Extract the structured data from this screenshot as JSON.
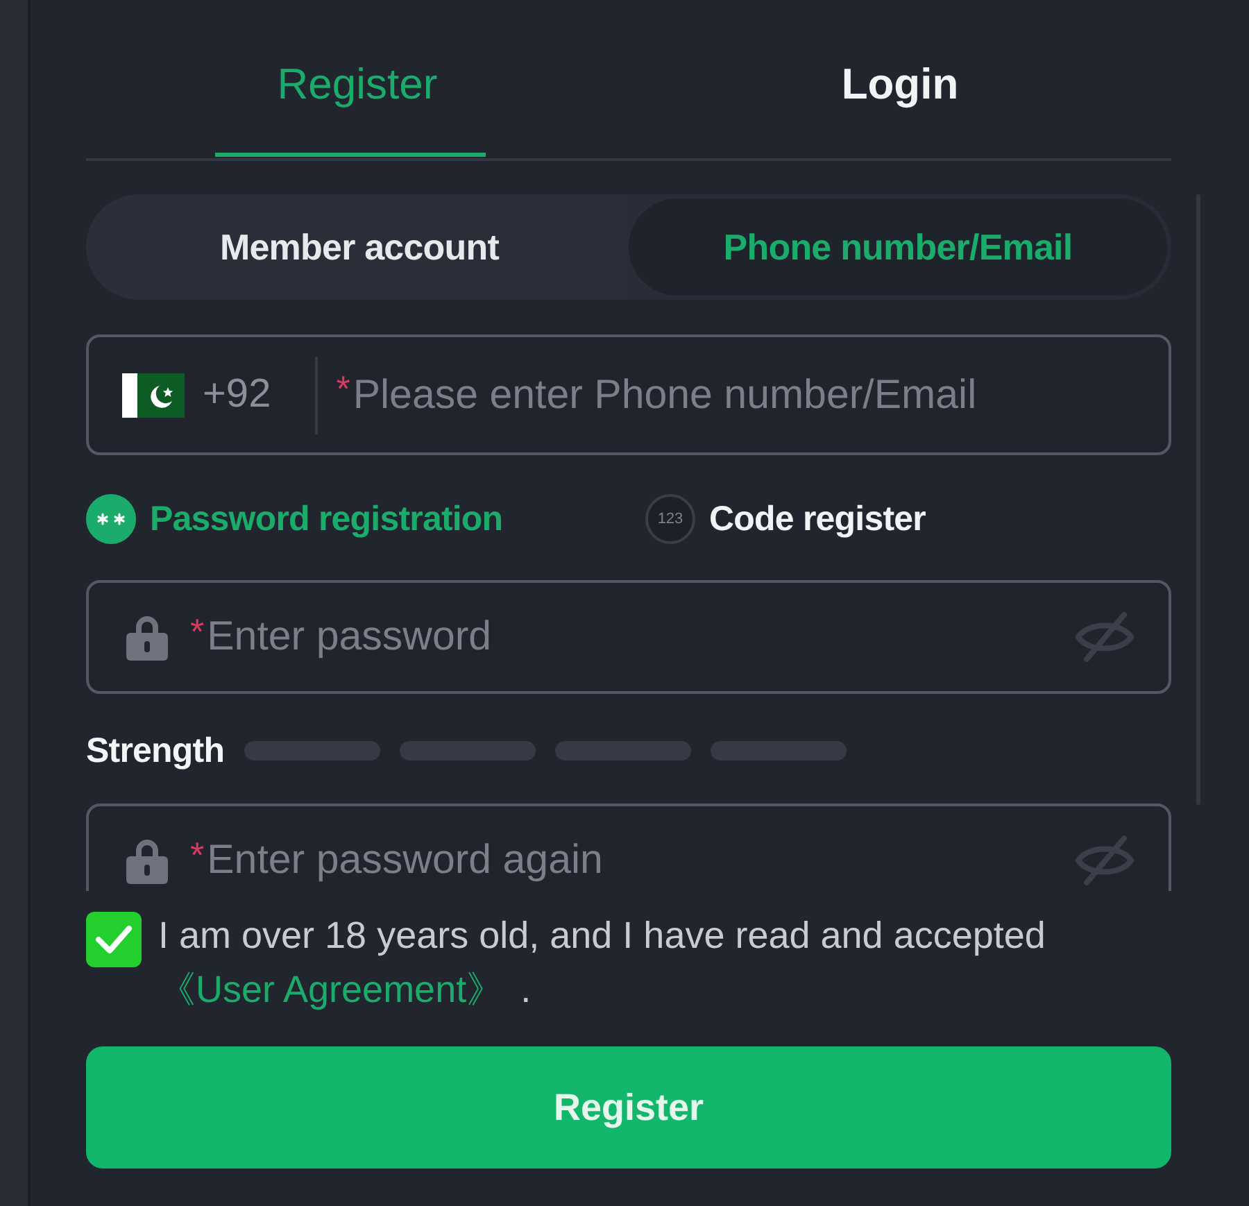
{
  "tabs": [
    {
      "label": "Register",
      "selected": true
    },
    {
      "label": "Login",
      "selected": false
    }
  ],
  "account_types": [
    {
      "label": "Member account",
      "selected": false
    },
    {
      "label": "Phone number/Email",
      "selected": true
    }
  ],
  "phone_field": {
    "country_code": "+92",
    "required_mark": "*",
    "placeholder": "Please enter Phone number/Email"
  },
  "register_methods": [
    {
      "kind": "password",
      "label": "Password registration",
      "selected": true
    },
    {
      "kind": "code",
      "label": "Code register",
      "selected": false,
      "icon_text": "123"
    }
  ],
  "password_field": {
    "required_mark": "*",
    "placeholder": "Enter password"
  },
  "strength": {
    "label": "Strength",
    "segments": [
      {
        "filled": false
      },
      {
        "filled": false
      },
      {
        "filled": false
      },
      {
        "filled": false
      }
    ]
  },
  "confirm_field": {
    "required_mark": "*",
    "placeholder": "Enter password again"
  },
  "agreement": {
    "checked": true,
    "text": "I am over 18 years old, and I have read and accepted",
    "link": "《User Agreement》",
    "suffix": "."
  },
  "submit_button": "Register"
}
